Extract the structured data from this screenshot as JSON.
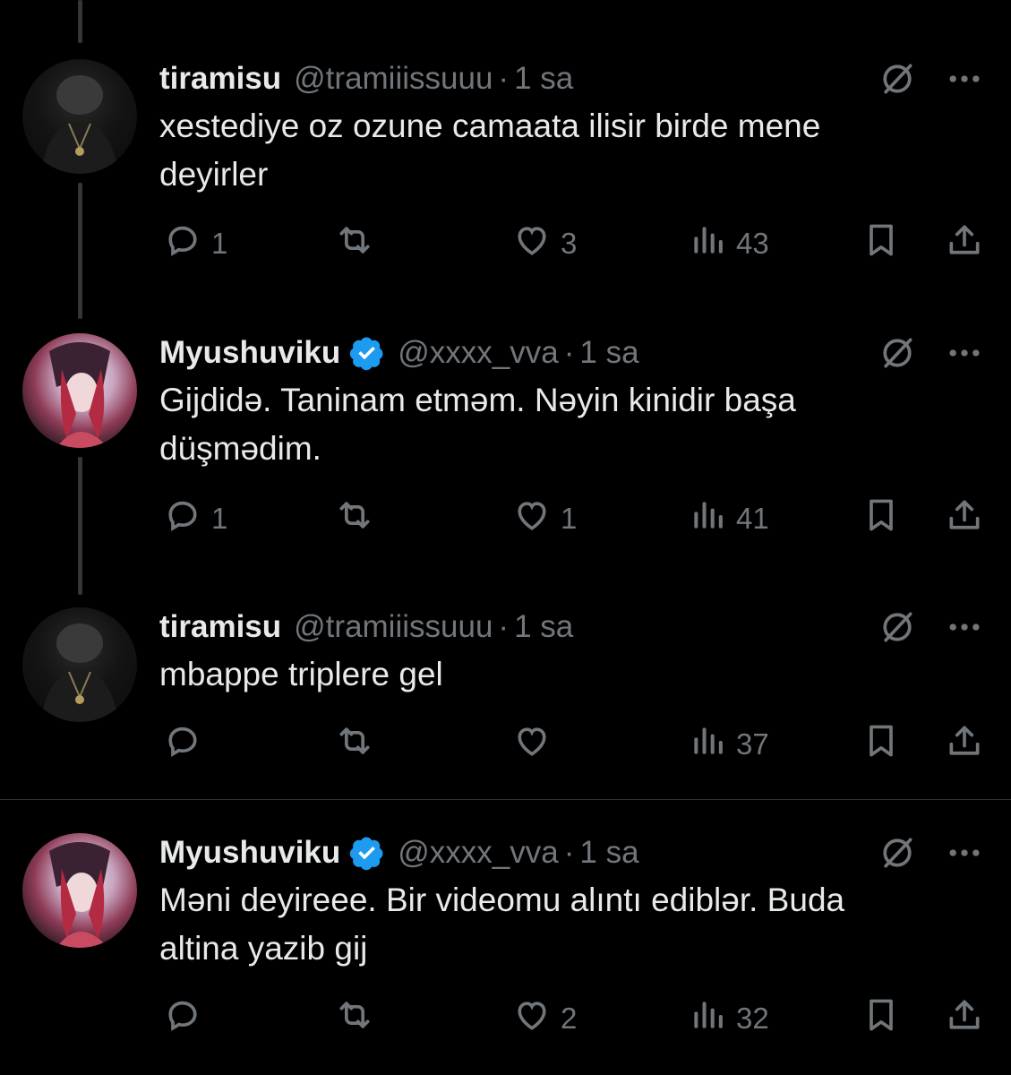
{
  "colors": {
    "background": "#000000",
    "text": "#e7e9ea",
    "muted": "#71767b",
    "verified": "#1d9bf0"
  },
  "tweets": [
    {
      "name": "tiramisu",
      "verified": false,
      "handle": "@tramiiissuuu",
      "dot": "·",
      "time": "1 sa",
      "text_lines": [
        "xestediye oz ozune camaata ilisir birde mene",
        "deyirler"
      ],
      "replies": "1",
      "retweets": "",
      "likes": "3",
      "views": "43"
    },
    {
      "name": "Myushuviku",
      "verified": true,
      "handle": "@xxxx_vva",
      "dot": "·",
      "time": "1 sa",
      "text_lines": [
        "Gijdidə. Taninam etməm. Nəyin kinidir başa",
        "düşmədim."
      ],
      "replies": "1",
      "retweets": "",
      "likes": "1",
      "views": "41"
    },
    {
      "name": "tiramisu",
      "verified": false,
      "handle": "@tramiiissuuu",
      "dot": "·",
      "time": "1 sa",
      "text_lines": [
        "mbappe triplere gel"
      ],
      "replies": "",
      "retweets": "",
      "likes": "",
      "views": "37"
    },
    {
      "name": "Myushuviku",
      "verified": true,
      "handle": "@xxxx_vva",
      "dot": "·",
      "time": "1 sa",
      "text_lines": [
        "Məni deyireee. Bir videomu alıntı ediblər. Buda",
        "altina yazib gij"
      ],
      "replies": "",
      "retweets": "",
      "likes": "2",
      "views": "32"
    }
  ],
  "icons": {
    "header": [
      "grok-slash-icon",
      "more-icon"
    ],
    "actions": [
      "reply-icon",
      "retweet-icon",
      "like-icon",
      "views-icon",
      "bookmark-icon",
      "share-icon"
    ]
  }
}
